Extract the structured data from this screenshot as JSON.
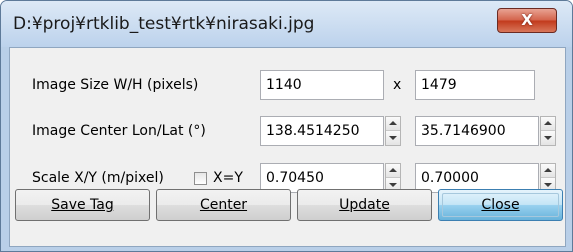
{
  "window": {
    "title": "D:¥proj¥rtklib_test¥rtk¥nirasaki.jpg",
    "close_label": "X"
  },
  "rows": {
    "image_size": {
      "label": "Image Size W/H (pixels)",
      "width": "1140",
      "separator": "x",
      "height": "1479"
    },
    "image_center": {
      "label": "Image Center Lon/Lat (°)",
      "lon": "138.4514250",
      "lat": "35.7146900"
    },
    "scale": {
      "label": "Scale X/Y (m/pixel)",
      "checkbox_label": "X=Y",
      "checkbox_checked": false,
      "x": "0.70450",
      "y": "0.70000"
    }
  },
  "buttons": {
    "save_tag": "Save Tag",
    "center": "Center",
    "update": "Update",
    "close": "Close"
  }
}
